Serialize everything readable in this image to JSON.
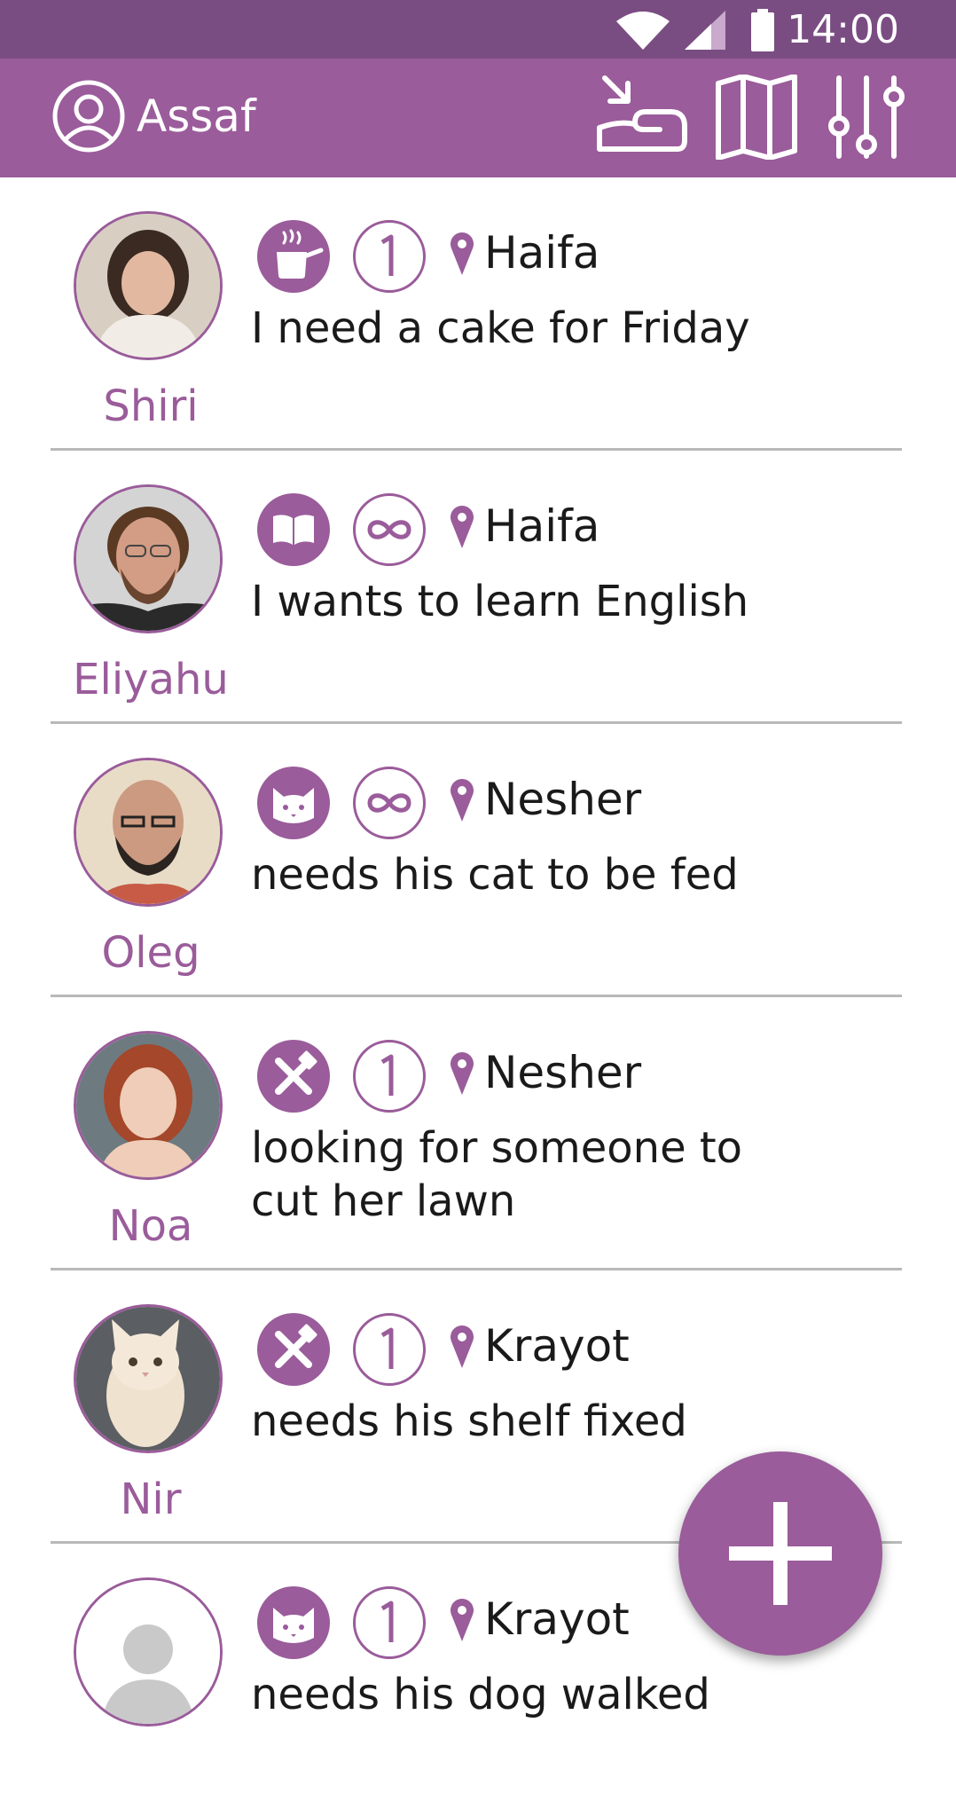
{
  "colors": {
    "brand": "#9a5c9a",
    "statusbar": "#7a4d82",
    "divider": "#b9b9b9"
  },
  "status_bar": {
    "time": "14:00",
    "icons": [
      "wifi-icon",
      "signal-icon",
      "battery-icon"
    ]
  },
  "app_bar": {
    "user_name": "Assaf",
    "account_icon": "account-circle-icon",
    "actions": [
      "request-hand-icon",
      "map-icon",
      "filter-sliders-icon"
    ]
  },
  "requests": [
    {
      "name": "Shiri",
      "category_icon": "cooking-pot-icon",
      "frequency": "1",
      "frequency_icon": "once-icon",
      "location": "Haifa",
      "text": "I need a cake for Friday"
    },
    {
      "name": "Eliyahu",
      "category_icon": "book-icon",
      "frequency": "∞",
      "frequency_icon": "recurring-icon",
      "location": "Haifa",
      "text": "I wants to learn English"
    },
    {
      "name": "Oleg",
      "category_icon": "cat-icon",
      "frequency": "∞",
      "frequency_icon": "recurring-icon",
      "location": "Nesher",
      "text": "needs his cat to be fed"
    },
    {
      "name": "Noa",
      "category_icon": "tools-icon",
      "frequency": "1",
      "frequency_icon": "once-icon",
      "location": "Nesher",
      "text": "looking for someone to cut her lawn"
    },
    {
      "name": "Nir",
      "category_icon": "tools-icon",
      "frequency": "1",
      "frequency_icon": "once-icon",
      "location": "Krayot",
      "text": "needs his shelf fixed"
    },
    {
      "name": "",
      "category_icon": "cat-icon",
      "frequency": "1",
      "frequency_icon": "once-icon",
      "location": "Krayot",
      "text": "needs his dog walked"
    }
  ],
  "fab": {
    "icon": "plus-icon"
  }
}
